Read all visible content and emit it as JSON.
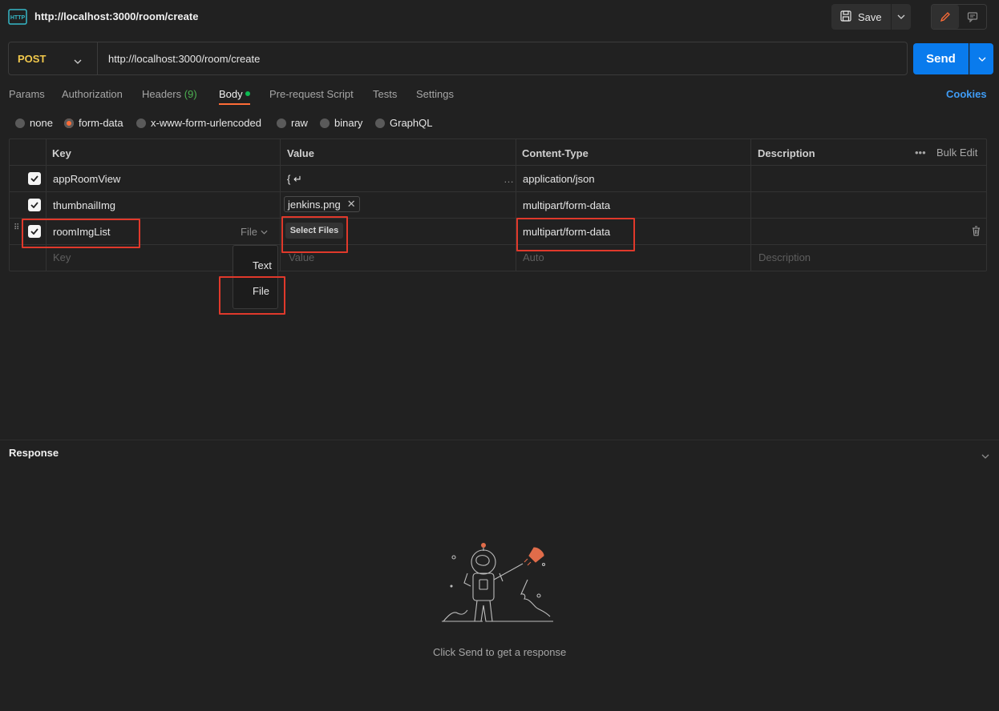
{
  "header": {
    "title": "http://localhost:3000/room/create",
    "save_label": "Save"
  },
  "request": {
    "method": "POST",
    "url": "http://localhost:3000/room/create",
    "send_label": "Send"
  },
  "tabs": {
    "params": "Params",
    "authorization": "Authorization",
    "headers": "Headers",
    "headers_count": "(9)",
    "body": "Body",
    "pre_request": "Pre-request Script",
    "tests": "Tests",
    "settings": "Settings",
    "cookies": "Cookies"
  },
  "body_types": {
    "none": "none",
    "form_data": "form-data",
    "urlencoded": "x-www-form-urlencoded",
    "raw": "raw",
    "binary": "binary",
    "graphql": "GraphQL",
    "selected": "form-data"
  },
  "table": {
    "headers": {
      "key": "Key",
      "value": "Value",
      "content_type": "Content-Type",
      "description": "Description",
      "bulk_edit": "Bulk Edit"
    },
    "rows": [
      {
        "key": "appRoomView",
        "value": "{ ↵",
        "content_type": "application/json"
      },
      {
        "key": "thumbnailImg",
        "value": "jenkins.png",
        "content_type": "multipart/form-data"
      },
      {
        "key": "roomImgList",
        "type": "File",
        "value_button": "Select Files",
        "content_type": "multipart/form-data"
      }
    ],
    "placeholder": {
      "key": "Key",
      "value": "Value",
      "content_type": "Auto",
      "description": "Description"
    },
    "type_menu": [
      "Text",
      "File"
    ]
  },
  "response": {
    "title": "Response",
    "hint": "Click Send to get a response"
  },
  "colors": {
    "accent": "#ff6c37",
    "send": "#097bed",
    "highlight_box": "#e0392b"
  }
}
